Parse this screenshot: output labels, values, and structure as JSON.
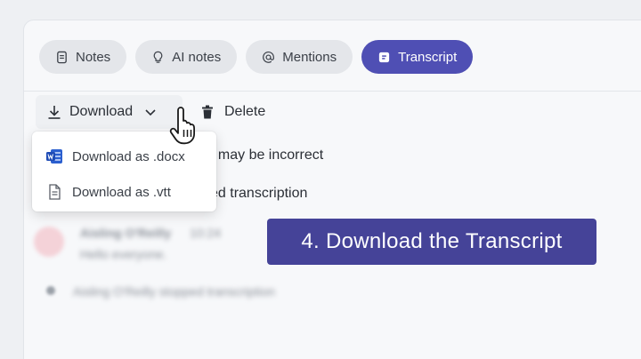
{
  "tabs": [
    {
      "label": "Notes",
      "icon": "notes-icon"
    },
    {
      "label": "AI notes",
      "icon": "lightbulb-icon"
    },
    {
      "label": "Mentions",
      "icon": "at-icon"
    },
    {
      "label": "Transcript",
      "icon": "transcript-icon",
      "active": true
    }
  ],
  "toolbar": {
    "download_label": "Download",
    "delete_label": "Delete"
  },
  "dropdown": {
    "items": [
      {
        "label": "Download as .docx",
        "icon": "word-icon"
      },
      {
        "label": "Download as .vtt",
        "icon": "file-icon"
      }
    ]
  },
  "content": {
    "line1_partial": "t may be incorrect",
    "line2_partial": "ed transcription",
    "blurred_speaker": "Aisling O'Reilly",
    "blurred_time": "10:24",
    "blurred_message": "Hello everyone.",
    "blurred_event": "Aisling O'Reilly stopped transcription"
  },
  "callout": {
    "text": "4. Download the Transcript"
  },
  "colors": {
    "accent": "#4f4fb4",
    "callout_bg": "#454398",
    "word_blue": "#2b5fcf"
  }
}
